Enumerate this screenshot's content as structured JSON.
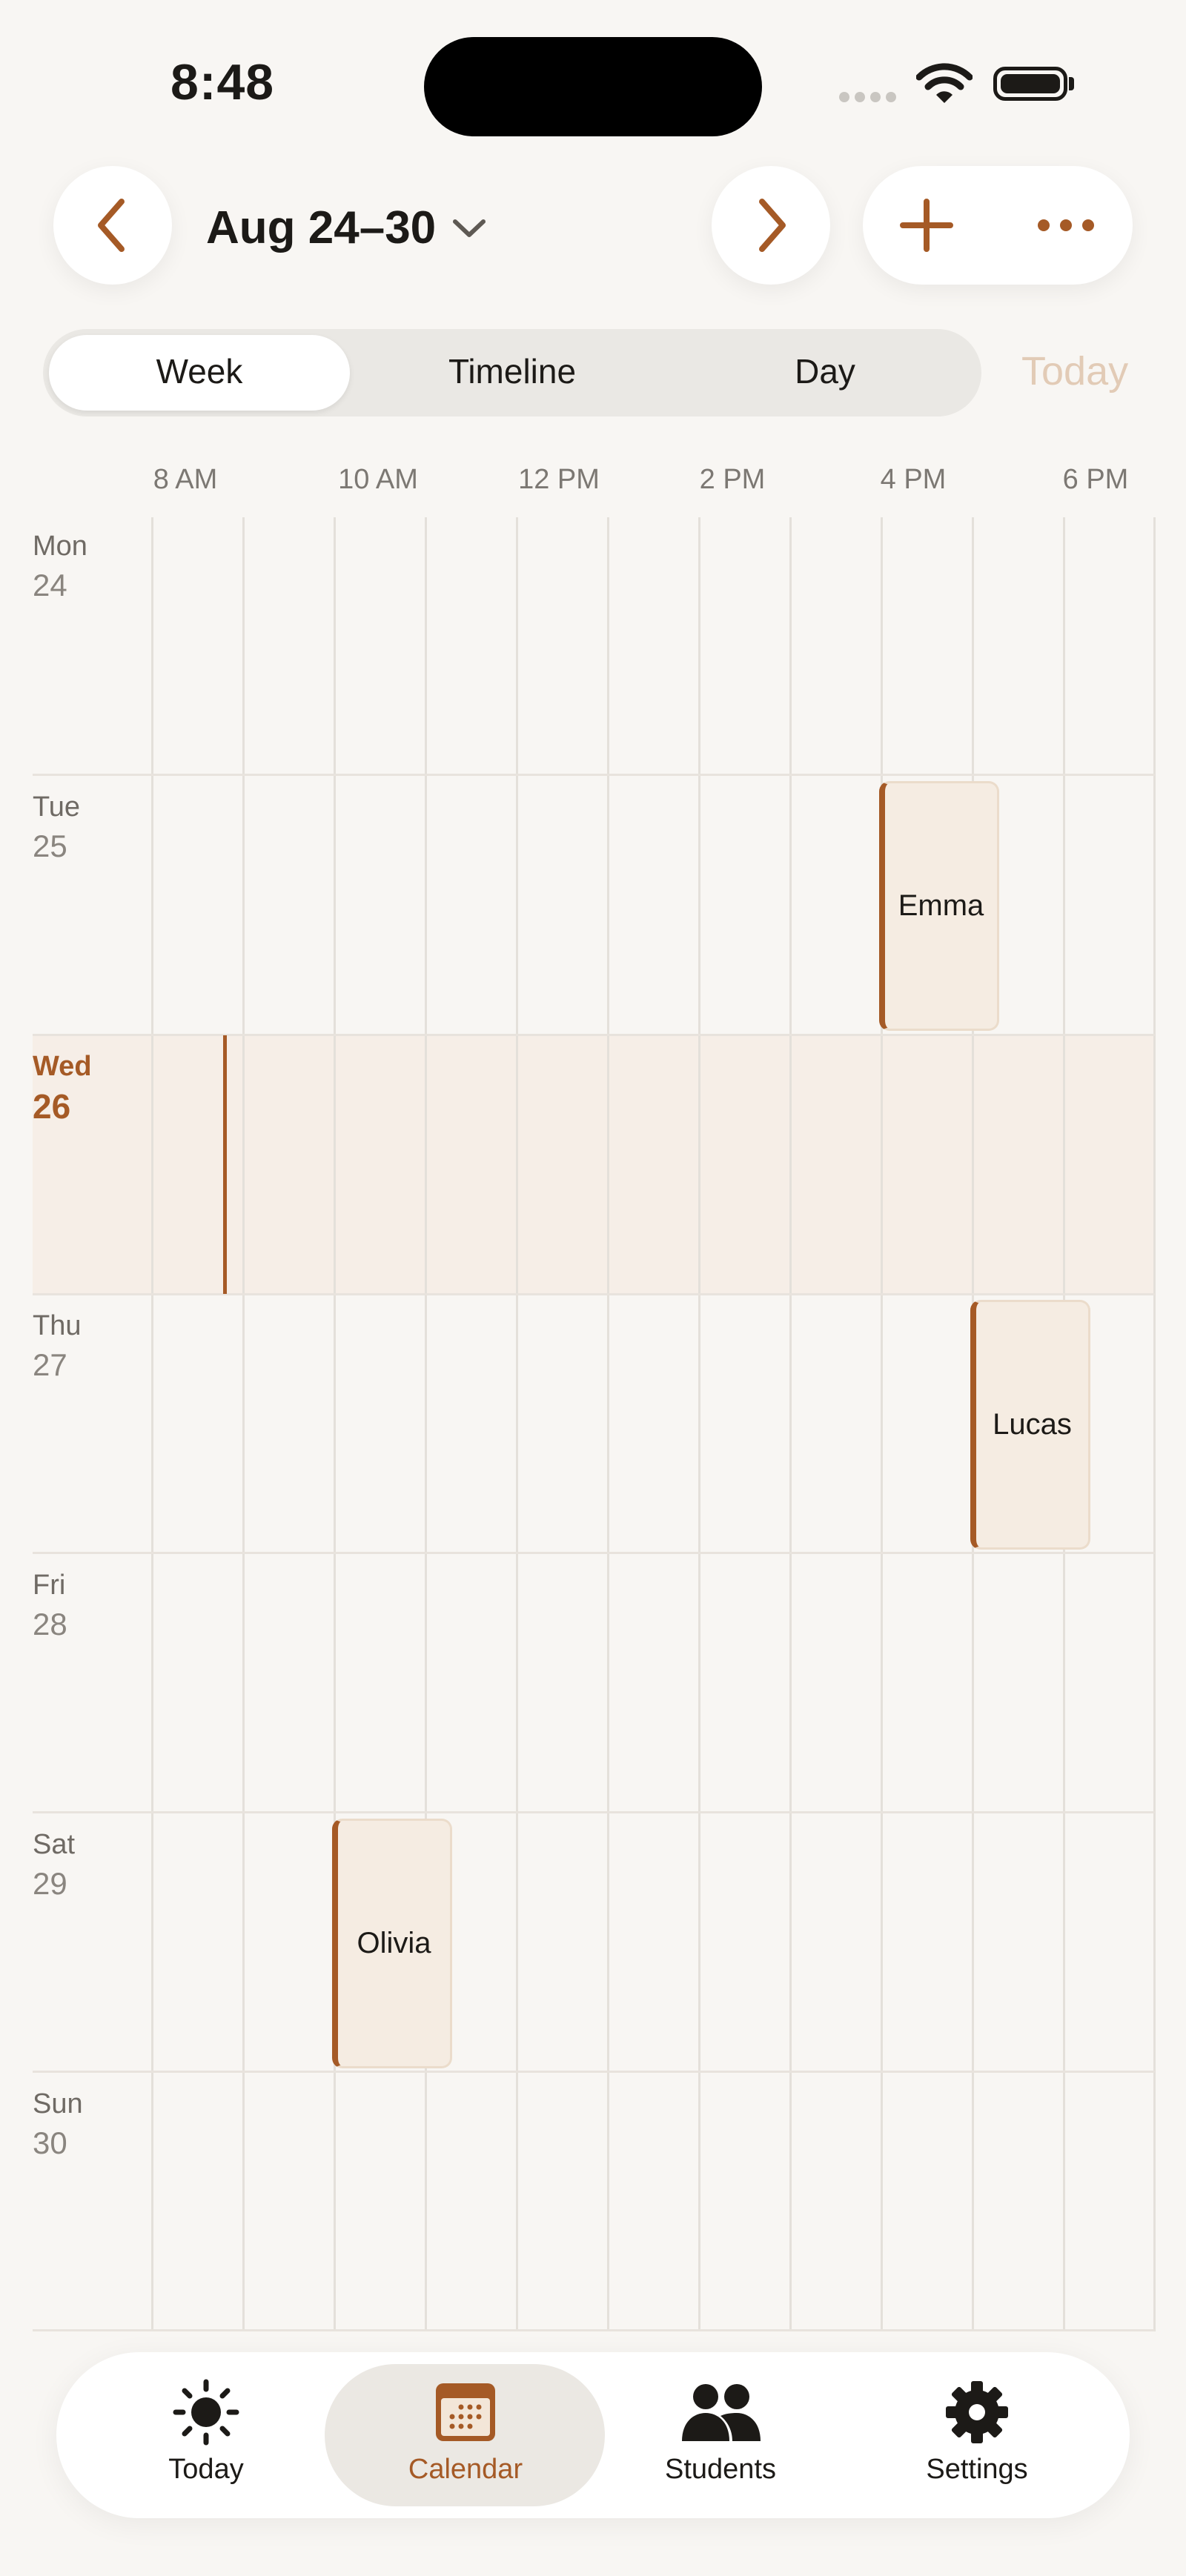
{
  "status_bar": {
    "time": "8:48"
  },
  "header": {
    "range": "Aug 24–30",
    "prev_icon": "chevron-left-icon",
    "next_icon": "chevron-right-icon",
    "add_icon": "plus-icon",
    "more_icon": "ellipsis-icon"
  },
  "segmented": {
    "options": [
      "Week",
      "Timeline",
      "Day"
    ],
    "selected": "Week"
  },
  "today_button": "Today",
  "hours": [
    "8 AM",
    "10 AM",
    "12 PM",
    "2 PM",
    "4 PM",
    "6 PM"
  ],
  "days": [
    {
      "name": "Mon",
      "num": "24"
    },
    {
      "name": "Tue",
      "num": "25"
    },
    {
      "name": "Wed",
      "num": "26",
      "is_today": true
    },
    {
      "name": "Thu",
      "num": "27"
    },
    {
      "name": "Fri",
      "num": "28"
    },
    {
      "name": "Sat",
      "num": "29"
    },
    {
      "name": "Sun",
      "num": "30"
    }
  ],
  "events": [
    {
      "title": "Emma",
      "day": "Tue 25",
      "start": "4 PM",
      "end": "5:15 PM"
    },
    {
      "title": "Lucas",
      "day": "Thu 27",
      "start": "5 PM",
      "end": "6:15 PM"
    },
    {
      "title": "Olivia",
      "day": "Sat 29",
      "start": "10 AM",
      "end": "11:15 AM"
    }
  ],
  "current_time": "8:48",
  "tabs": [
    {
      "label": "Today",
      "icon": "sun-icon"
    },
    {
      "label": "Calendar",
      "icon": "calendar-icon",
      "active": true
    },
    {
      "label": "Students",
      "icon": "people-icon"
    },
    {
      "label": "Settings",
      "icon": "gear-icon"
    }
  ],
  "colors": {
    "accent": "#A55A26",
    "background": "#F8F6F3",
    "today_row": "#F6EEE7",
    "event_fill": "#F5ECE2"
  }
}
